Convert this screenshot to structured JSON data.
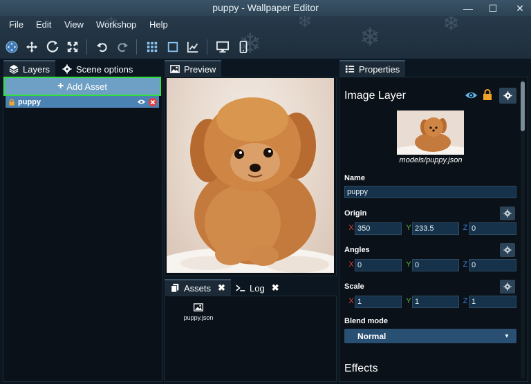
{
  "window": {
    "title": "puppy - Wallpaper Editor"
  },
  "window_controls": [
    {
      "name": "minimize-button",
      "glyph": "—"
    },
    {
      "name": "maximize-button",
      "glyph": "☐"
    },
    {
      "name": "close-button",
      "glyph": "✕"
    }
  ],
  "menu": [
    "File",
    "Edit",
    "View",
    "Workshop",
    "Help"
  ],
  "toolbar": {
    "icons": [
      "move-mode-icon",
      "translate-icon",
      "rotate-icon",
      "scale-icon",
      "undo-icon",
      "redo-icon",
      "grid-icon",
      "bounds-icon",
      "chart-icon",
      "desktop-preview-icon",
      "mobile-preview-icon"
    ]
  },
  "left_panel": {
    "tabs": [
      {
        "label": "Layers",
        "icon": "layers-icon",
        "active": true
      },
      {
        "label": "Scene options",
        "icon": "gear-icon",
        "active": false
      }
    ],
    "add_asset_label": "Add Asset",
    "layers": [
      {
        "name": "puppy",
        "locked": true,
        "visible": true
      }
    ]
  },
  "preview_panel": {
    "tab_label": "Preview",
    "tab_icon": "image-icon"
  },
  "bottom_panel": {
    "tabs": [
      {
        "label": "Assets",
        "icon": "copy-icon"
      },
      {
        "label": "Log",
        "icon": "terminal-icon"
      }
    ],
    "assets": [
      {
        "name": "puppy.json",
        "icon": "image-icon"
      }
    ]
  },
  "properties": {
    "tab_label": "Properties",
    "tab_icon": "list-icon",
    "header": "Image Layer",
    "model_path": "models/puppy.json",
    "name_label": "Name",
    "name_value": "puppy",
    "origin": {
      "label": "Origin",
      "x": "350",
      "y": "233.5",
      "z": "0"
    },
    "angles": {
      "label": "Angles",
      "x": "0",
      "y": "0",
      "z": "0"
    },
    "scale": {
      "label": "Scale",
      "x": "1",
      "y": "1",
      "z": "1"
    },
    "axes": {
      "x": "X",
      "y": "Y",
      "z": "Z"
    },
    "blend_mode_label": "Blend mode",
    "blend_mode_value": "Normal",
    "effects_label": "Effects"
  },
  "colors": {
    "accent": "#4b82b4",
    "add_asset_bg": "#6e9fc4",
    "highlight_outline": "#2fe23a",
    "eye_icon": "#5fb6e8",
    "lock_icon": "#f0a52a",
    "remove_icon": "#e23c3c",
    "axis_x": "#e0413b",
    "axis_y": "#4cc23b",
    "axis_z": "#3f7ee0"
  }
}
